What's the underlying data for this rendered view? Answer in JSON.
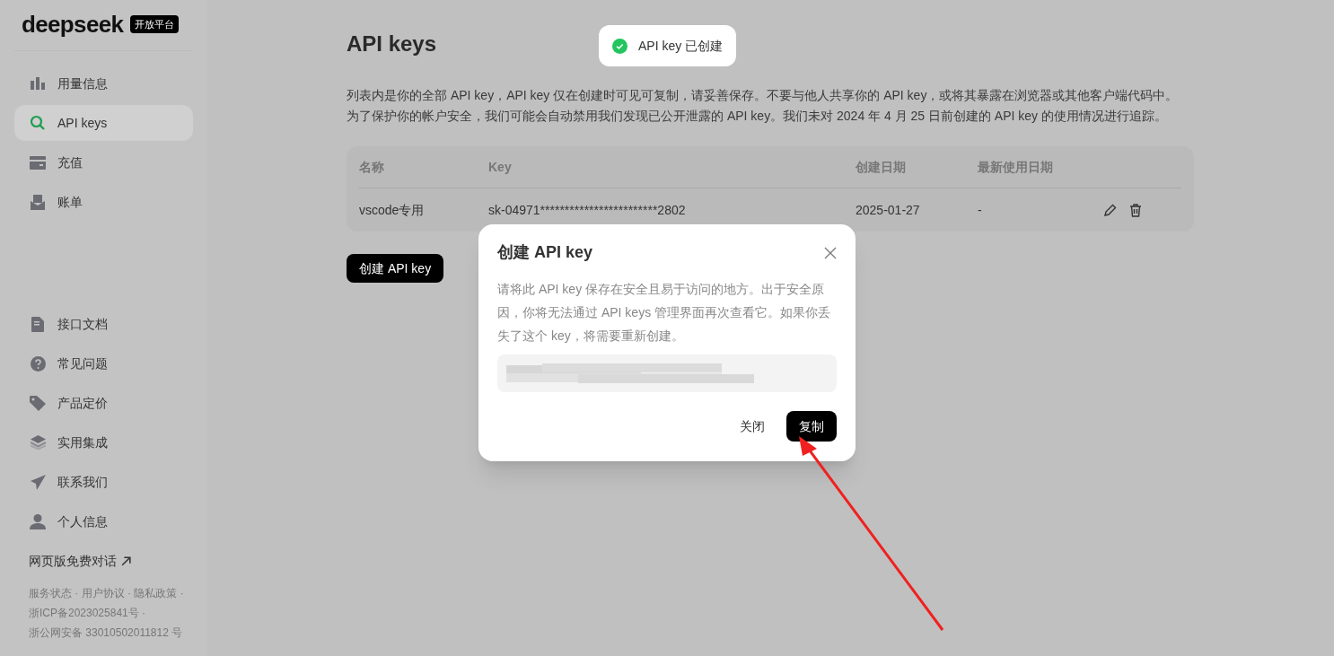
{
  "sidebar": {
    "logo": "deepseek",
    "badge": "开放平台",
    "nav_items": [
      {
        "label": "用量信息",
        "selected": false
      },
      {
        "label": "API keys",
        "selected": true
      },
      {
        "label": "充值",
        "selected": false
      },
      {
        "label": "账单",
        "selected": false
      }
    ],
    "secondary_items": [
      {
        "label": "接口文档"
      },
      {
        "label": "常见问题"
      },
      {
        "label": "产品定价"
      },
      {
        "label": "实用集成"
      },
      {
        "label": "联系我们"
      },
      {
        "label": "个人信息"
      }
    ],
    "web_chat_link": "网页版免费对话",
    "footer": [
      "服务状态 · 用户协议 · 隐私政策 ·",
      "浙ICP备2023025841号 ·",
      "浙公网安备 33010502011812 号"
    ]
  },
  "page": {
    "title": "API keys",
    "description": [
      "列表内是你的全部 API key，API key 仅在创建时可见可复制，请妥善保存。不要与他人共享你的 API key，或将其暴露在浏览器或其他客户端代码中。",
      "为了保护你的帐户安全，我们可能会自动禁用我们发现已公开泄露的 API key。我们未对 2024 年 4 月 25 日前创建的 API key 的使用情况进行追踪。"
    ],
    "table": {
      "columns": [
        "名称",
        "Key",
        "创建日期",
        "最新使用日期"
      ],
      "rows": [
        {
          "name": "vscode专用",
          "key": "sk-04971************************2802",
          "created": "2025-01-27",
          "last_used": "-"
        }
      ]
    },
    "create_button": "创建 API key"
  },
  "toast": {
    "text": "API key 已创建"
  },
  "dialog": {
    "title": "创建 API key",
    "body": "请将此 API key 保存在安全且易于访问的地方。出于安全原因，你将无法通过 API keys 管理界面再次查看它。如果你丢失了这个 key，将需要重新创建。",
    "buttons": [
      {
        "label": "关闭",
        "kind": "text"
      },
      {
        "label": "复制",
        "kind": "primary"
      }
    ]
  }
}
